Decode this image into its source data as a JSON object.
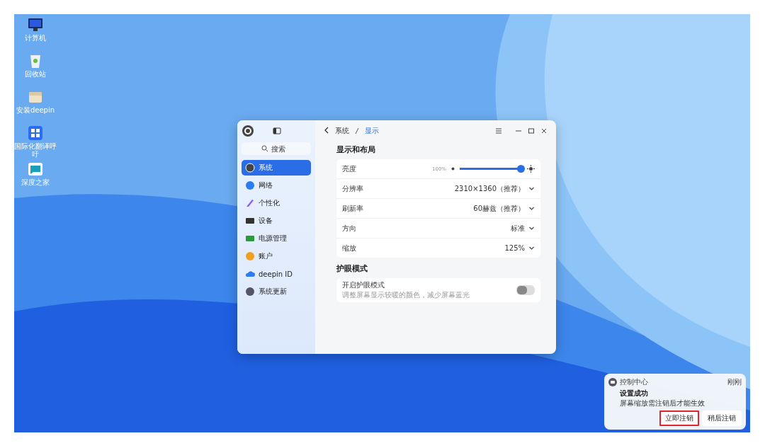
{
  "desktop_icons": [
    {
      "label": "计算机",
      "kind": "computer"
    },
    {
      "label": "回收站",
      "kind": "trash"
    },
    {
      "label": "安装deepin",
      "kind": "installer"
    },
    {
      "label": "国际化翻译呼吁",
      "kind": "translate"
    },
    {
      "label": "深度之家",
      "kind": "home"
    }
  ],
  "window": {
    "search": {
      "placeholder": "搜索"
    },
    "sidebar": {
      "items": [
        {
          "label": "系统",
          "kind": "system",
          "selected": true
        },
        {
          "label": "网络",
          "kind": "network",
          "selected": false
        },
        {
          "label": "个性化",
          "kind": "personal",
          "selected": false
        },
        {
          "label": "设备",
          "kind": "device",
          "selected": false
        },
        {
          "label": "电源管理",
          "kind": "power",
          "selected": false
        },
        {
          "label": "账户",
          "kind": "account",
          "selected": false
        },
        {
          "label": "deepin ID",
          "kind": "cloud",
          "selected": false
        },
        {
          "label": "系统更新",
          "kind": "update",
          "selected": false
        }
      ]
    },
    "breadcrumb": [
      "系统",
      "显示"
    ],
    "sections": [
      {
        "title": "显示和布局",
        "rows": [
          {
            "kind": "slider",
            "label": "亮度",
            "reading": "100%",
            "level": 0.96
          },
          {
            "kind": "select",
            "label": "分辨率",
            "value": "2310×1360（推荐）"
          },
          {
            "kind": "select",
            "label": "刷新率",
            "value": "60赫兹（推荐）"
          },
          {
            "kind": "select",
            "label": "方向",
            "value": "标准"
          },
          {
            "kind": "select",
            "label": "缩放",
            "value": "125%"
          }
        ]
      },
      {
        "title": "护眼模式",
        "rows": [
          {
            "kind": "toggle",
            "label": "开启护眼模式",
            "description": "调整屏幕显示较暖的颜色，减少屏幕蓝光",
            "on": false
          }
        ]
      }
    ]
  },
  "notification": {
    "app": "控制中心",
    "time": "刚刚",
    "title": "设置成功",
    "body": "屏幕缩放需注销后才能生效",
    "buttons": [
      {
        "label": "立即注销",
        "highlighted": true
      },
      {
        "label": "稍后注销",
        "highlighted": false
      }
    ]
  }
}
